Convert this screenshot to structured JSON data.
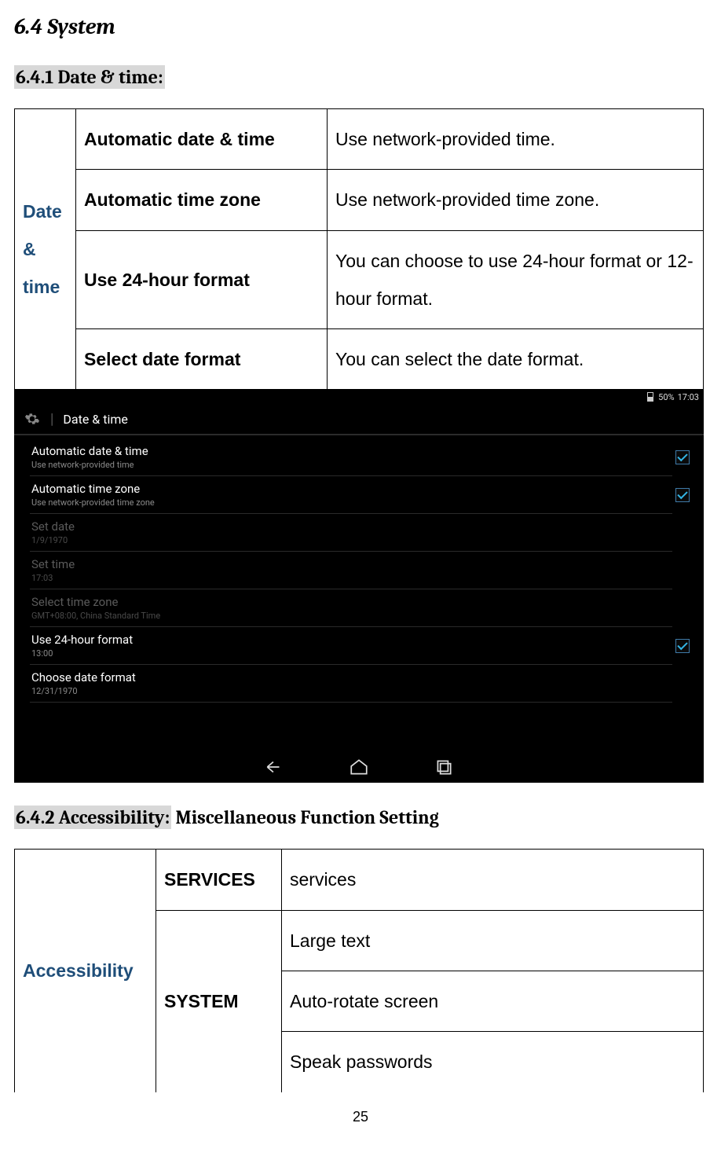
{
  "headings": {
    "h1": "6.4 System",
    "h2_1": "6.4.1 Date & time:",
    "h2_2_hl": "6.4.2 Accessibility:",
    "h2_2_plain": " Miscellaneous Function Setting"
  },
  "table1": {
    "rowhead": "Date & time",
    "rows": [
      {
        "label": "Automatic date & time",
        "desc": "Use network-provided time."
      },
      {
        "label": "Automatic time zone",
        "desc": "Use network-provided time zone."
      },
      {
        "label": "Use 24-hour format",
        "desc": "You can choose to use 24-hour format or 12-hour format."
      },
      {
        "label": "Select date format",
        "desc": "You can select the date format."
      }
    ]
  },
  "screenshot": {
    "status": {
      "battery_pct": "50%",
      "time": "17:03"
    },
    "title": "Date & time",
    "items": [
      {
        "label": "Automatic date & time",
        "sub": "Use network-provided time",
        "checked": true,
        "disabled": false
      },
      {
        "label": "Automatic time zone",
        "sub": "Use network-provided time zone",
        "checked": true,
        "disabled": false
      },
      {
        "label": "Set date",
        "sub": "1/9/1970",
        "checked": null,
        "disabled": true
      },
      {
        "label": "Set time",
        "sub": "17:03",
        "checked": null,
        "disabled": true
      },
      {
        "label": "Select time zone",
        "sub": "GMT+08:00, China Standard Time",
        "checked": null,
        "disabled": true
      },
      {
        "label": "Use 24-hour format",
        "sub": "13:00",
        "checked": true,
        "disabled": false
      },
      {
        "label": "Choose date format",
        "sub": "12/31/1970",
        "checked": null,
        "disabled": false
      }
    ]
  },
  "table2": {
    "rowhead": "Accessibility",
    "col_services": "SERVICES",
    "val_services": "services",
    "col_system": "SYSTEM",
    "system_rows": [
      "Large text",
      "Auto-rotate screen",
      "Speak passwords"
    ]
  },
  "pagenum": "25"
}
